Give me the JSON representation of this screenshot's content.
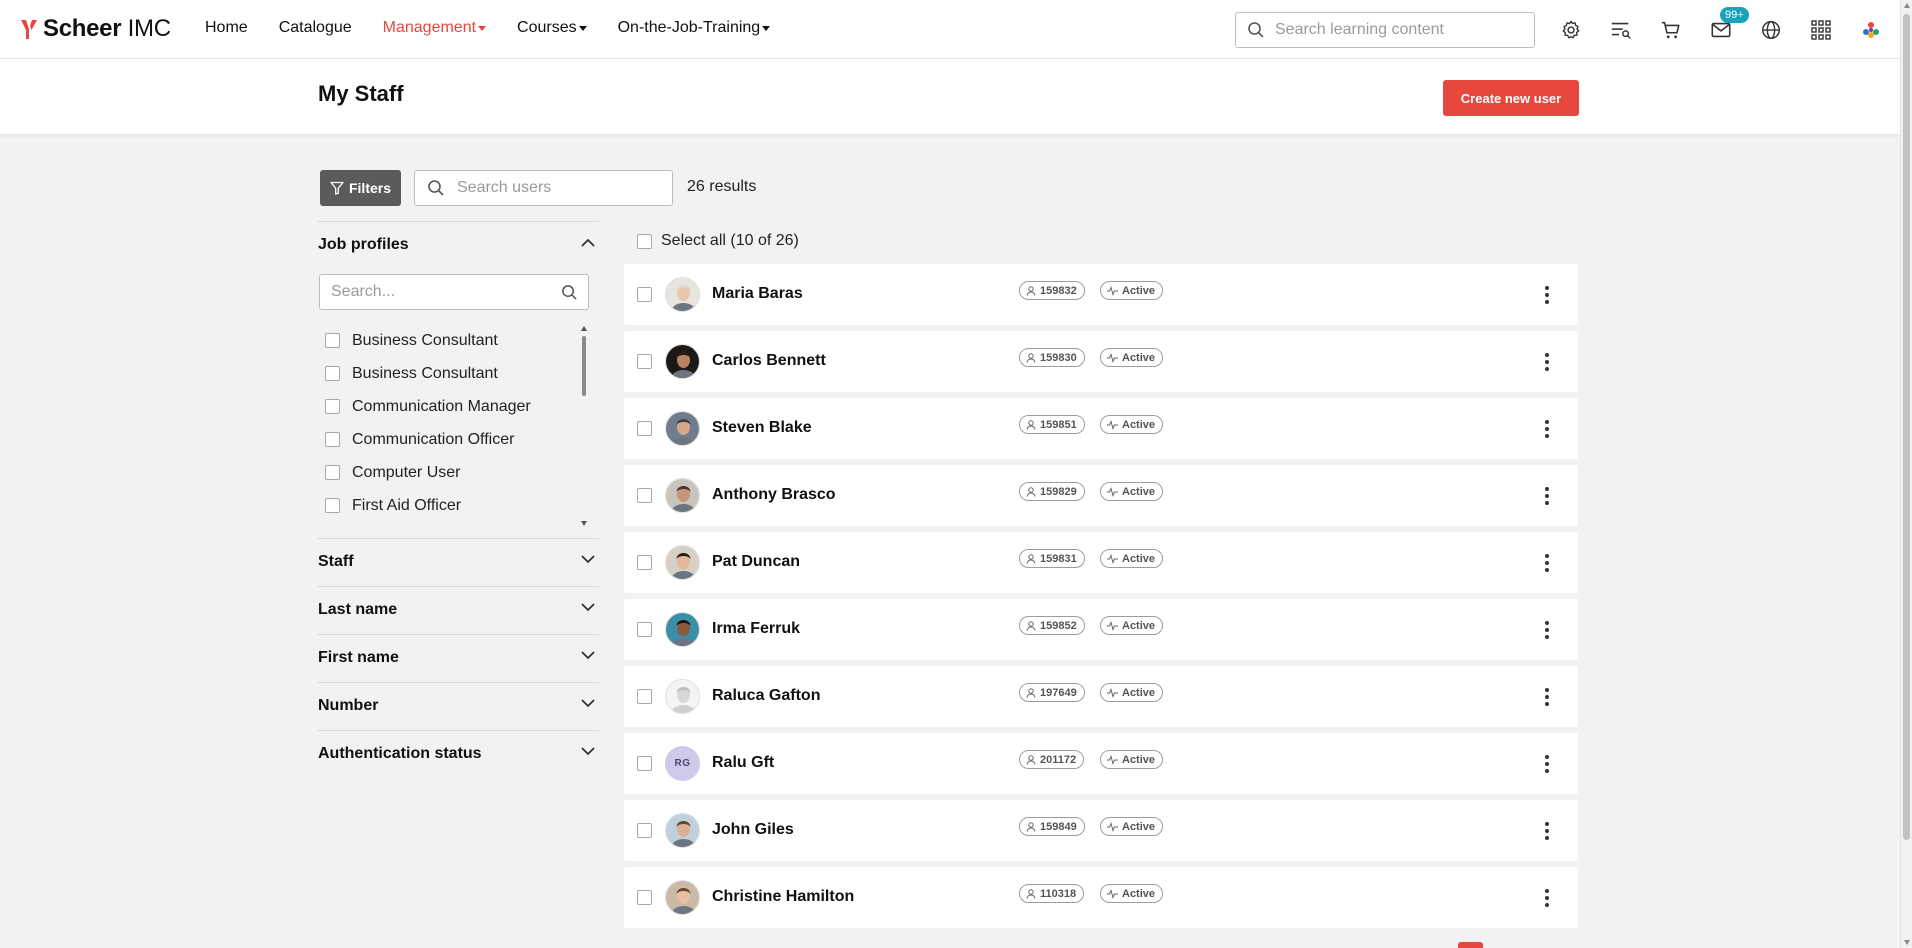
{
  "brand": {
    "name_bold": "Scheer",
    "name_light": " IMC",
    "accent": "#e8473e"
  },
  "nav": {
    "items": [
      {
        "label": "Home",
        "has_caret": false,
        "active": false
      },
      {
        "label": "Catalogue",
        "has_caret": false,
        "active": false
      },
      {
        "label": "Management",
        "has_caret": true,
        "active": true
      },
      {
        "label": "Courses",
        "has_caret": true,
        "active": false
      },
      {
        "label": "On-the-Job-Training",
        "has_caret": true,
        "active": false
      }
    ],
    "search_placeholder": "Search learning content",
    "icons": [
      "gear-icon",
      "playlist-search-icon",
      "cart-icon",
      "mail-icon",
      "globe-icon",
      "apps-grid-icon",
      "avatar-icon"
    ],
    "mail_badge": "99+"
  },
  "page": {
    "title": "My Staff",
    "create_button": "Create new user"
  },
  "toolbar": {
    "filters_label": "Filters",
    "search_placeholder": "Search users",
    "results": "26 results"
  },
  "facets": {
    "job_profiles": {
      "title": "Job profiles",
      "search_placeholder": "Search...",
      "options": [
        "Business Consultant",
        "Business Consultant",
        "Communication Manager",
        "Communication Officer",
        "Computer User",
        "First Aid Officer"
      ]
    },
    "collapsed": [
      {
        "title": "Staff"
      },
      {
        "title": "Last name"
      },
      {
        "title": "First name"
      },
      {
        "title": "Number"
      },
      {
        "title": "Authentication status"
      }
    ]
  },
  "list": {
    "select_all": "Select all (10 of 26)",
    "users": [
      {
        "name": "Maria Baras",
        "id": "159832",
        "status": "Active",
        "avatar": "photo",
        "skin": "#e9c7ad",
        "hair": "#d9d9d9",
        "bg": "#e8e4df"
      },
      {
        "name": "Carlos Bennett",
        "id": "159830",
        "status": "Active",
        "avatar": "photo",
        "skin": "#b78361",
        "hair": "#2a1a12",
        "bg": "#1c1816"
      },
      {
        "name": "Steven Blake",
        "id": "159851",
        "status": "Active",
        "avatar": "photo",
        "skin": "#d6a88a",
        "hair": "#3c3f49",
        "bg": "#6f7d8c"
      },
      {
        "name": "Anthony Brasco",
        "id": "159829",
        "status": "Active",
        "avatar": "photo",
        "skin": "#c99577",
        "hair": "#4a3328",
        "bg": "#c9c4bd"
      },
      {
        "name": "Pat Duncan",
        "id": "159831",
        "status": "Active",
        "avatar": "photo",
        "skin": "#e2b79a",
        "hair": "#2b1d15",
        "bg": "#d7d0c4"
      },
      {
        "name": "Irma Ferruk",
        "id": "159852",
        "status": "Active",
        "avatar": "photo",
        "skin": "#8a5a3f",
        "hair": "#1c1412",
        "bg": "#3a8fa6"
      },
      {
        "name": "Raluca Gafton",
        "id": "197649",
        "status": "Active",
        "avatar": "placeholder",
        "skin": "#d8d8d8",
        "hair": "#bcbcbc",
        "bg": "#f4f4f4"
      },
      {
        "name": "Ralu Gft",
        "id": "201172",
        "status": "Active",
        "avatar": "initials",
        "initials": "RG"
      },
      {
        "name": "John Giles",
        "id": "159849",
        "status": "Active",
        "avatar": "photo",
        "skin": "#ddb096",
        "hair": "#5b4433",
        "bg": "#bfd0dc"
      },
      {
        "name": "Christine Hamilton",
        "id": "110318",
        "status": "Active",
        "avatar": "photo",
        "skin": "#e7bfa4",
        "hair": "#6a4630",
        "bg": "#cbb9a8"
      }
    ]
  }
}
